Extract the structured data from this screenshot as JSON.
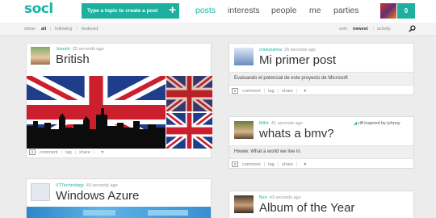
{
  "header": {
    "logo": "socl",
    "create_button_label": "Type a topic to create a post",
    "create_button_icon": "plus-icon",
    "nav": [
      "posts",
      "interests",
      "people",
      "me",
      "parties"
    ],
    "active_nav": "posts",
    "notification_count": "0",
    "accent_color": "#1db09f"
  },
  "filter": {
    "show_label": "show:",
    "all": "all",
    "following": "following",
    "featured": "featured",
    "sort_label": "sort:",
    "newest": "newest",
    "activity": "activity"
  },
  "actions": {
    "comment": "comment",
    "tag": "tag",
    "share": "share",
    "count": "0"
  },
  "posts": [
    {
      "author": "Joseph",
      "time": "25 seconds ago",
      "title": "British"
    },
    {
      "author": "chelopalma",
      "time": "26 seconds ago",
      "title": "Mi primer post",
      "body": "Evaluando el potencial de este proyecto de Microsoft"
    },
    {
      "author": "Mihir",
      "time": "41 seconds ago",
      "title": "whats a bmv?",
      "body": "Hwww. What a world we live in.",
      "riff": "riff inspired by johnny"
    },
    {
      "author": "VTTechnology",
      "time": "43 seconds ago",
      "title": "Windows Azure"
    },
    {
      "author": "Ben",
      "time": "43 seconds ago",
      "title": "Album of the Year"
    }
  ]
}
